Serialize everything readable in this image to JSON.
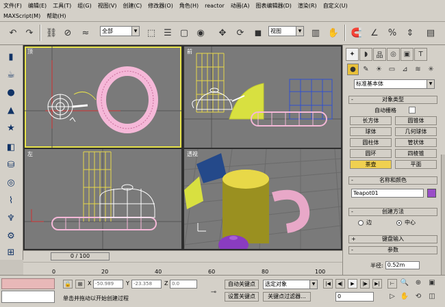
{
  "menu": {
    "row1": [
      "文件(F)",
      "编辑(E)",
      "工具(T)",
      "组(G)",
      "视图(V)",
      "创建(C)",
      "修改器(O)",
      "角色(H)",
      "reactor",
      "动画(A)",
      "图表编辑器(D)",
      "渲染(R)",
      "自定义(U)"
    ],
    "row2": [
      "MAXScript(M)",
      "帮助(H)"
    ]
  },
  "toolbar": {
    "selection_filter": "全部",
    "ref_coord": "视图"
  },
  "viewports": {
    "top_label": "顶",
    "front_label": "前",
    "left_label": "左",
    "persp_label": "透视"
  },
  "timeline": {
    "slider": "0 / 100",
    "ticks": [
      "0",
      "20",
      "40",
      "60",
      "80",
      "100"
    ]
  },
  "command_panel": {
    "category": "标准基本体",
    "object_type_title": "对象类型",
    "autogrid": "自动栅格",
    "buttons": [
      "长方体",
      "圆锥体",
      "球体",
      "几何球体",
      "圆柱体",
      "管状体",
      "圆环",
      "四棱锥",
      "茶壶",
      "平面"
    ],
    "name_color_title": "名称和颜色",
    "name_value": "Teapot01",
    "creation_method_title": "创建方法",
    "radio_edge": "边",
    "radio_center": "中心",
    "keyboard_entry_title": "键盘输入",
    "params_title": "参数",
    "radius_label": "半径:",
    "radius_value": "0.52m",
    "swatch_color": "#9a4ec8"
  },
  "status": {
    "x_label": "X",
    "x_value": "-50.989",
    "y_label": "Y",
    "y_value": "-23.358",
    "z_label": "Z",
    "z_value": "0.0",
    "prompt": "单击并拖动以开始创建过程",
    "auto_key": "自动关键点",
    "set_key": "设置关键点",
    "selected_object": "选定对象",
    "key_filters": "关键点过滤器...",
    "frame": "0"
  }
}
